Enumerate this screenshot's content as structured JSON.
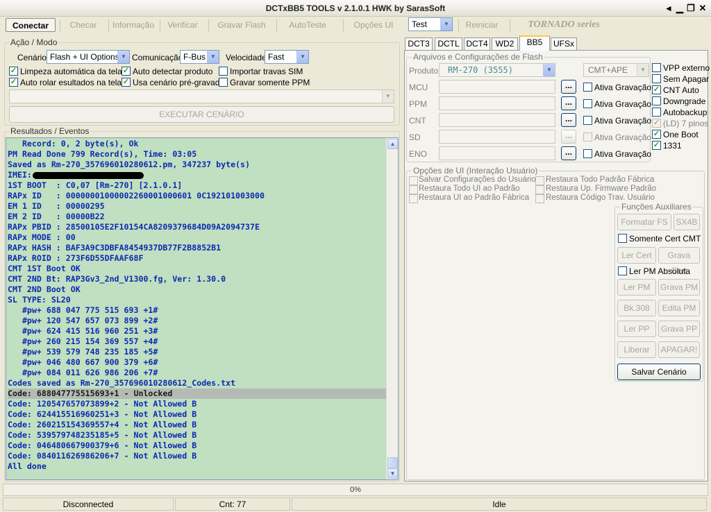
{
  "window": {
    "title": "DCTxBB5 TOOLS v 2.1.0.1 HWK by SarasSoft"
  },
  "toolbar": {
    "connect": "Conectar",
    "check": "Checar",
    "info": "Informação",
    "verify": "Verificar",
    "flash": "Gravar Flash",
    "autotest": "AutoTeste",
    "ui_options": "Opções UI",
    "mode_select": "Test",
    "restart": "Reiniciar",
    "brand": "TORNADO series"
  },
  "action_mode": {
    "title": "Ação / Modo",
    "scenario_label": "Cenário",
    "scenario_value": "Flash + UI Options",
    "comm_label": "Comunicação",
    "comm_value": "F-Bus",
    "speed_label": "Velocidade",
    "speed_value": "Fast",
    "checkboxes": [
      {
        "label": "Limpeza automática da tela",
        "checked": true
      },
      {
        "label": "Auto detectar produto",
        "checked": true
      },
      {
        "label": "Importar travas SIM",
        "checked": false
      },
      {
        "label": "Auto rolar esultados na tela",
        "checked": true
      },
      {
        "label": "Usa cenário pré-gravado",
        "checked": true
      },
      {
        "label": "Gravar somente PPM",
        "checked": false
      }
    ],
    "execute_button": "EXECUTAR CENÁRIO"
  },
  "results": {
    "title": "Resultados / Eventos",
    "lines": [
      "   Record: 0, 2 byte(s), Ok",
      "PM Read Done 799 Record(s), Time: 03:05",
      "Saved as Rm-270_357696010280612.pm, 347237 byte(s)",
      "IMEI: ",
      "1ST BOOT  : C0,07 [Rm-270] [2.1.0.1]",
      "RAPx ID   : 00000001000002260001000601 0C192101003000",
      "EM 1 ID   : 00000295",
      "EM 2 ID   : 00000B22",
      "RAPx PBID : 28500105E2F10154CA8209379684D09A2094737E",
      "RAPx MODE : 00",
      "RAPx HASH : BAF3A9C3DBFA8454937DB77F2B8852B1",
      "RAPx ROID : 273F6D55DFAAF68F",
      "CMT 1ST Boot OK",
      "CMT 2ND Bt: RAP3Gv3_2nd_V1300.fg, Ver: 1.30.0",
      "CMT 2ND Boot OK",
      "SL TYPE: SL20",
      "   #pw+ 688 047 775 515 693 +1#",
      "   #pw+ 120 547 657 073 899 +2#",
      "   #pw+ 624 415 516 960 251 +3#",
      "   #pw+ 260 215 154 369 557 +4#",
      "   #pw+ 539 579 748 235 185 +5#",
      "   #pw+ 046 480 667 900 379 +6#",
      "   #pw+ 084 011 626 986 206 +7#",
      "Codes saved as Rm-270_357696010280612_Codes.txt",
      "Code: 688047775515693+1 - Unlocked",
      "Code: 120547657073899+2 - Not Allowed B",
      "Code: 624415516960251+3 - Not Allowed B",
      "Code: 260215154369557+4 - Not Allowed B",
      "Code: 539579748235185+5 - Not Allowed B",
      "Code: 046480667900379+6 - Not Allowed B",
      "Code: 084011626986206+7 - Not Allowed B",
      "All done"
    ],
    "highlighted_index": 24
  },
  "tabs": [
    "DCT3",
    "DCTL",
    "DCT4",
    "WD2",
    "BB5",
    "UFSx"
  ],
  "active_tab": "BB5",
  "flash_files": {
    "title": "Arquivos e Configurações de Flash",
    "product_label": "Produto",
    "product_value": "RM-270  (3555)",
    "variant_value": "CMT+APE",
    "rows": [
      {
        "label": "MCU",
        "burn_label": "Ativa Gravação"
      },
      {
        "label": "PPM",
        "burn_label": "Ativa Gravação"
      },
      {
        "label": "CNT",
        "burn_label": "Ativa Gravação"
      },
      {
        "label": "SD",
        "burn_label": "Ativa Gravação"
      },
      {
        "label": "ENO",
        "burn_label": "Ativa Gravação"
      }
    ],
    "dots_label": "...",
    "options": [
      {
        "label": "VPP externo",
        "checked": false
      },
      {
        "label": "Sem Apagar",
        "checked": false
      },
      {
        "label": "CNT Auto",
        "checked": true
      },
      {
        "label": "Downgrade",
        "checked": false
      },
      {
        "label": "Autobackup",
        "checked": false
      },
      {
        "label": "(LD) 7 pinos",
        "checked": true
      },
      {
        "label": "One Boot",
        "checked": true
      },
      {
        "label": "1331",
        "checked": true
      }
    ]
  },
  "ui_options": {
    "title": "Opções de UI (Interação Usuário)",
    "items": [
      "Salvar Configurações do Usuário",
      "Restaura Todo Padrão Fábrica",
      "Restaura Todo UI ao Padrão",
      "Restaura Up. Firmware Padrão",
      "Restaura UI ao Padrão Fábrica",
      "Restaura Código Trav. Usuário"
    ]
  },
  "aux_functions": {
    "title": "Funções Auxiliares",
    "format_fs": "Formatar FS",
    "sx4b": "SX4B",
    "only_cert_cmt": "Somente Cert CMT",
    "read_cert": "Ler Cert",
    "write_cert": "Grava Cert",
    "read_pm_absolute": "Ler PM Absoluta",
    "read_pm": "Ler PM",
    "write_pm": "Grava PM",
    "bk308": "Bk.308",
    "edit_pm": "Edita PM",
    "read_pp": "Ler PP",
    "write_pp": "Grava PP",
    "release": "Liberar",
    "erase": "APAGAR!",
    "save_scenario": "Salvar Cenário"
  },
  "status": {
    "progress": "0%",
    "connection": "Disconnected",
    "counter": "Cnt: 77",
    "state": "Idle"
  }
}
